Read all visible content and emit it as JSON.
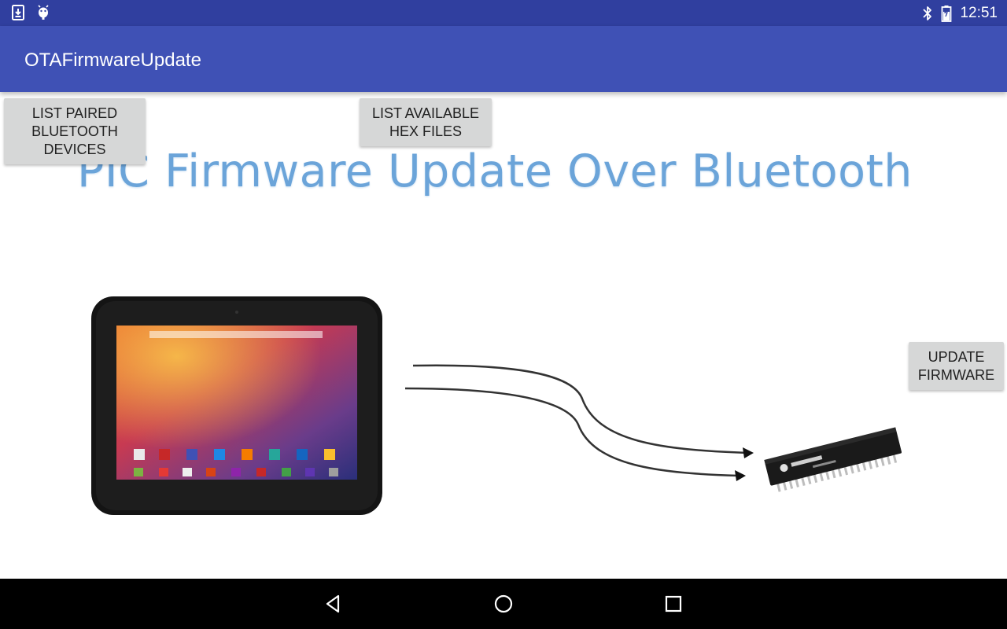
{
  "status_bar": {
    "time": "12:51",
    "left_icons": [
      "download-icon",
      "android-icon"
    ],
    "right_icons": [
      "bluetooth-icon",
      "battery-icon"
    ]
  },
  "app_bar": {
    "title": "OTAFirmwareUpdate"
  },
  "buttons": {
    "list_paired_label": "LIST PAIRED BLUETOOTH DEVICES",
    "list_hex_label": "LIST AVAILABLE HEX FILES",
    "update_firmware_label": "UPDATE FIRMWARE"
  },
  "hero": {
    "title": "PIC Firmware Update Over Bluetooth",
    "images": [
      "tablet-image",
      "pic-chip-image",
      "arrow-icon"
    ]
  },
  "nav_bar": {
    "icons": [
      "back-icon",
      "home-icon",
      "recents-icon"
    ]
  }
}
